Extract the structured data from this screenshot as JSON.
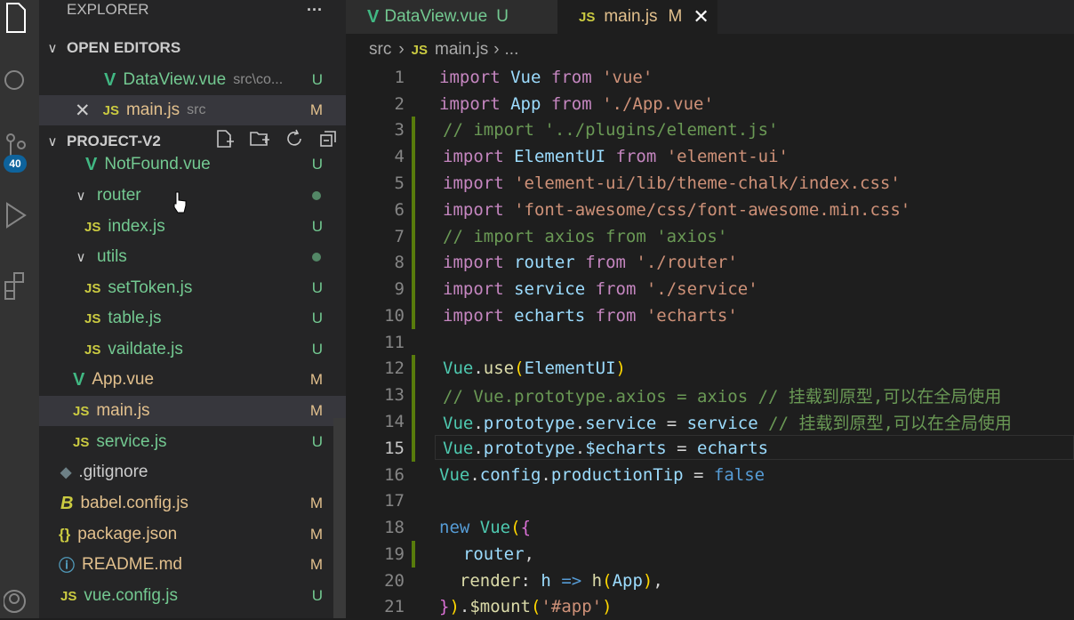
{
  "activity_bar": {
    "scm_badge": "40"
  },
  "sidebar": {
    "title": "EXPLORER",
    "more": "···",
    "open_editors": {
      "header": "OPEN EDITORS",
      "items": [
        {
          "name": "DataView.vue",
          "path": "src\\co...",
          "status": "U"
        },
        {
          "name": "main.js",
          "path": "src",
          "status": "M"
        }
      ]
    },
    "project": {
      "header": "PROJECT-V2",
      "items": [
        {
          "name": "NotFound.vue",
          "status": "U"
        },
        {
          "name": "router"
        },
        {
          "name": "index.js",
          "status": "U"
        },
        {
          "name": "utils"
        },
        {
          "name": "setToken.js",
          "status": "U"
        },
        {
          "name": "table.js",
          "status": "U"
        },
        {
          "name": "vaildate.js",
          "status": "U"
        },
        {
          "name": "App.vue",
          "status": "M"
        },
        {
          "name": "main.js",
          "status": "M"
        },
        {
          "name": "service.js",
          "status": "U"
        },
        {
          "name": ".gitignore"
        },
        {
          "name": "babel.config.js",
          "status": "M"
        },
        {
          "name": "package.json",
          "status": "M"
        },
        {
          "name": "README.md",
          "status": "M"
        },
        {
          "name": "vue.config.js",
          "status": "U"
        }
      ]
    }
  },
  "tabs": [
    {
      "label": "DataView.vue",
      "status": "U"
    },
    {
      "label": "main.js",
      "status": "M"
    }
  ],
  "breadcrumb": {
    "folder": "src",
    "file": "main.js",
    "rest": "..."
  },
  "editor": {
    "line_numbers": [
      "1",
      "2",
      "3",
      "4",
      "5",
      "6",
      "7",
      "8",
      "9",
      "10",
      "11",
      "12",
      "13",
      "14",
      "15",
      "16",
      "17",
      "18",
      "19",
      "20",
      "21"
    ],
    "lines": [
      "import Vue from 'vue'",
      "import App from './App.vue'",
      "// import '../plugins/element.js'",
      "import ElementUI from 'element-ui'",
      "import 'element-ui/lib/theme-chalk/index.css'",
      "import 'font-awesome/css/font-awesome.min.css'",
      "// import axios from 'axios'",
      "import router from './router'",
      "import service from './service'",
      "import echarts from 'echarts'",
      "",
      "Vue.use(ElementUI)",
      "// Vue.prototype.axios = axios // 挂载到原型,可以在全局使用",
      "Vue.prototype.service = service // 挂载到原型,可以在全局使用",
      "Vue.prototype.$echarts = echarts",
      "Vue.config.productionTip = false",
      "",
      "new Vue({",
      "  router,",
      "  render: h => h(App),",
      "}).$mount('#app')"
    ],
    "current_line": "15"
  }
}
